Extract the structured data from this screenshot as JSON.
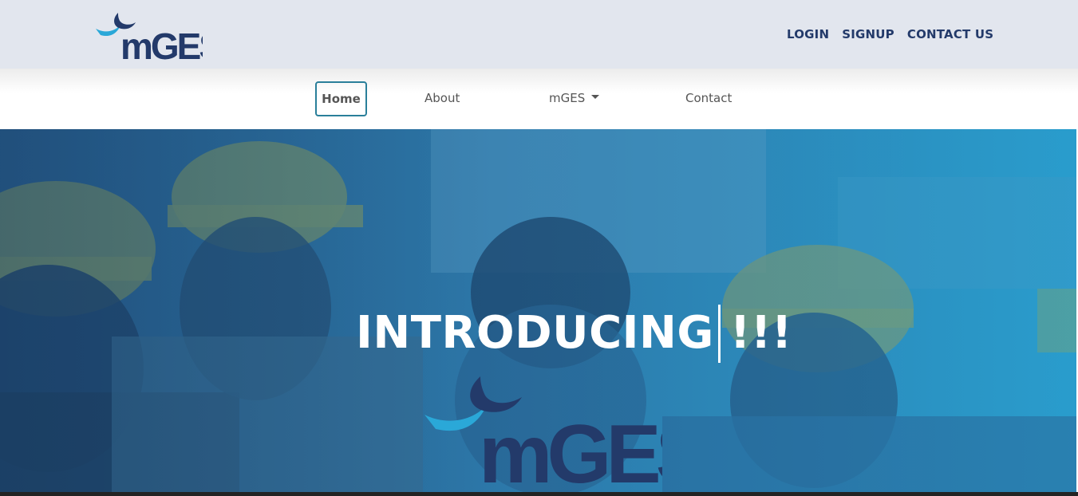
{
  "brand": {
    "logo_text": "mGES",
    "logo_icon": "mges-swoosh-logo-icon"
  },
  "top_links": {
    "login": "LOGIN",
    "signup": "SIGNUP",
    "contact_us": "CONTACT US"
  },
  "nav": {
    "home": "Home",
    "about": "About",
    "mges": "mGES",
    "contact": "Contact",
    "mges_dropdown_icon": "caret-down-icon"
  },
  "hero": {
    "title": "INTRODUCING !!!",
    "logo_text": "mGES"
  },
  "colors": {
    "brand_navy": "#233a6a",
    "brand_cyan": "#2aa8d8",
    "topbar_bg": "#e2e6ee",
    "home_border": "#2a7f9a",
    "hero_blue": "#2f86b3"
  }
}
